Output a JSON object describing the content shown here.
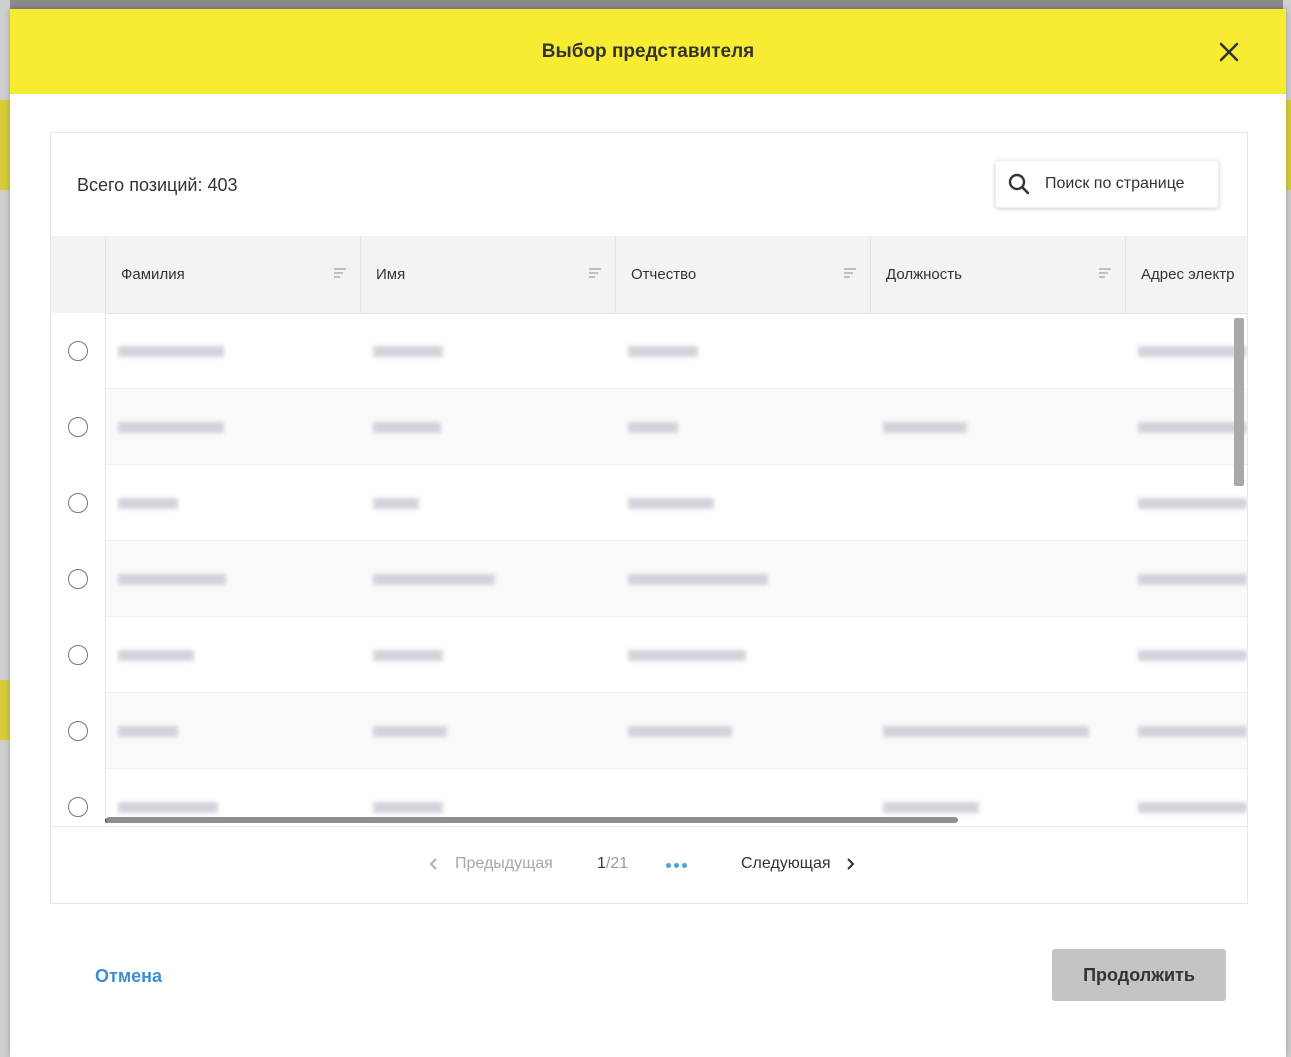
{
  "modal": {
    "title": "Выбор представителя",
    "close_icon": "close-icon"
  },
  "table": {
    "total_label": "Всего позиций: 403",
    "search_placeholder": "Поиск по странице",
    "columns": [
      "Фамилия",
      "Имя",
      "Отчество",
      "Должность",
      "Адрес электр"
    ]
  },
  "pagination": {
    "prev_label": "Предыдущая",
    "next_label": "Следующая",
    "current_page": "1",
    "total_pages": "/21"
  },
  "footer": {
    "cancel_label": "Отмена",
    "continue_label": "Продолжить"
  },
  "colors": {
    "header_bg": "#f7ec31",
    "link": "#3d8ed6",
    "disabled_button": "#c4c4c4"
  }
}
